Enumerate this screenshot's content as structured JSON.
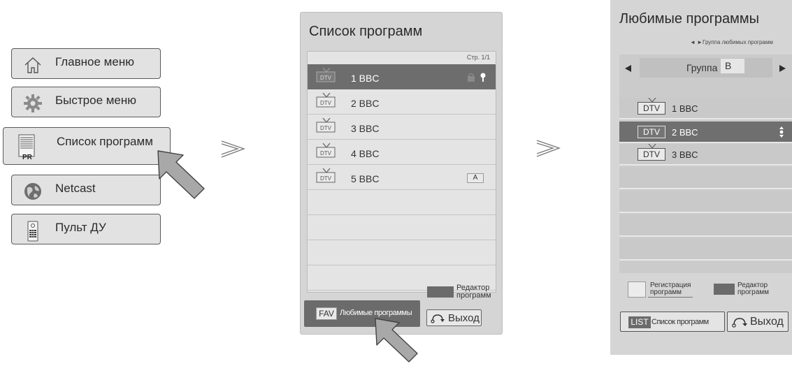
{
  "main_menu": {
    "items": [
      {
        "label": "Главное меню",
        "icon": "home-icon"
      },
      {
        "label": "Быстрое меню",
        "icon": "gear-icon"
      },
      {
        "label": "Список программ",
        "icon": "program-list-icon",
        "badge": "PR"
      },
      {
        "label": "Netcast",
        "icon": "globe-icon"
      },
      {
        "label": "Пульт ДУ",
        "icon": "remote-control-icon"
      }
    ]
  },
  "program_list": {
    "title": "Список программ",
    "page": "Стр. 1/1",
    "channels": [
      {
        "type": "DTV",
        "name": "1 BBC"
      },
      {
        "type": "DTV",
        "name": "2 BBC"
      },
      {
        "type": "DTV",
        "name": "3 BBC"
      },
      {
        "type": "DTV",
        "name": "4 BBC"
      },
      {
        "type": "DTV",
        "name": "5 BBC",
        "tag": "A"
      }
    ],
    "editor_label_line1": "Редактор",
    "editor_label_line2": "программ",
    "fav_key": "FAV",
    "fav_label": "Любимые программы",
    "exit_label": "Выход"
  },
  "favorites": {
    "title": "Любимые программы",
    "hint": "◄ ►Группа любимых программ",
    "group_label": "Группа",
    "group_value": "B",
    "channels": [
      {
        "type": "DTV",
        "name": "1 BBC"
      },
      {
        "type": "DTV",
        "name": "2 BBC"
      },
      {
        "type": "DTV",
        "name": "3 BBC"
      }
    ],
    "register_line1": "Регистрация",
    "register_line2": "программ",
    "editor_line1": "Редактор",
    "editor_line2": "программ",
    "list_key": "LIST",
    "list_label": "Список программ",
    "exit_label": "Выход"
  },
  "colors": {
    "panel_bg": "#d5d5d5",
    "selected_row": "#6d6d6d",
    "menu_bg": "#e2e2e2"
  }
}
